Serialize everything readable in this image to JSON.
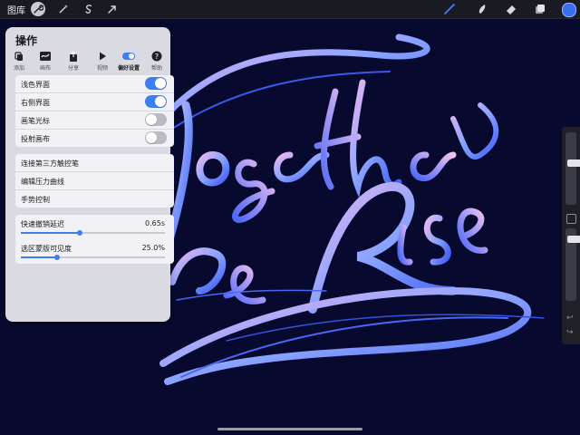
{
  "topbar": {
    "gallery_label": "图库",
    "left_tools": [
      "wrench-icon",
      "magic-wand-icon",
      "selection-icon",
      "transform-arrow-icon"
    ],
    "right_tools": [
      "brush-icon",
      "smudge-icon",
      "eraser-icon",
      "layers-icon"
    ],
    "current_color": "#3a6ff2"
  },
  "panel": {
    "title": "操作",
    "tabs": [
      {
        "label": "添加",
        "icon": "add-icon"
      },
      {
        "label": "画布",
        "icon": "canvas-icon"
      },
      {
        "label": "分享",
        "icon": "share-icon"
      },
      {
        "label": "视频",
        "icon": "video-icon"
      },
      {
        "label": "偏好设置",
        "icon": "preferences-toggle-icon"
      },
      {
        "label": "帮助",
        "icon": "help-icon"
      }
    ],
    "selected_tab": "偏好设置",
    "toggles": [
      {
        "label": "浅色界面",
        "on": true
      },
      {
        "label": "右侧界面",
        "on": true
      },
      {
        "label": "画笔光标",
        "on": false
      },
      {
        "label": "投射画布",
        "on": false
      }
    ],
    "links": [
      "连接第三方触控笔",
      "编辑压力曲线",
      "手势控制"
    ],
    "sliders": [
      {
        "label": "快速撤销延迟",
        "value": "0.65s",
        "fraction": 0.41
      },
      {
        "label": "选区蒙版可见度",
        "value": "25.0%",
        "fraction": 0.25
      }
    ]
  },
  "colors": {
    "accent": "#3d7ff0",
    "canvas_background": "#070a2e"
  }
}
